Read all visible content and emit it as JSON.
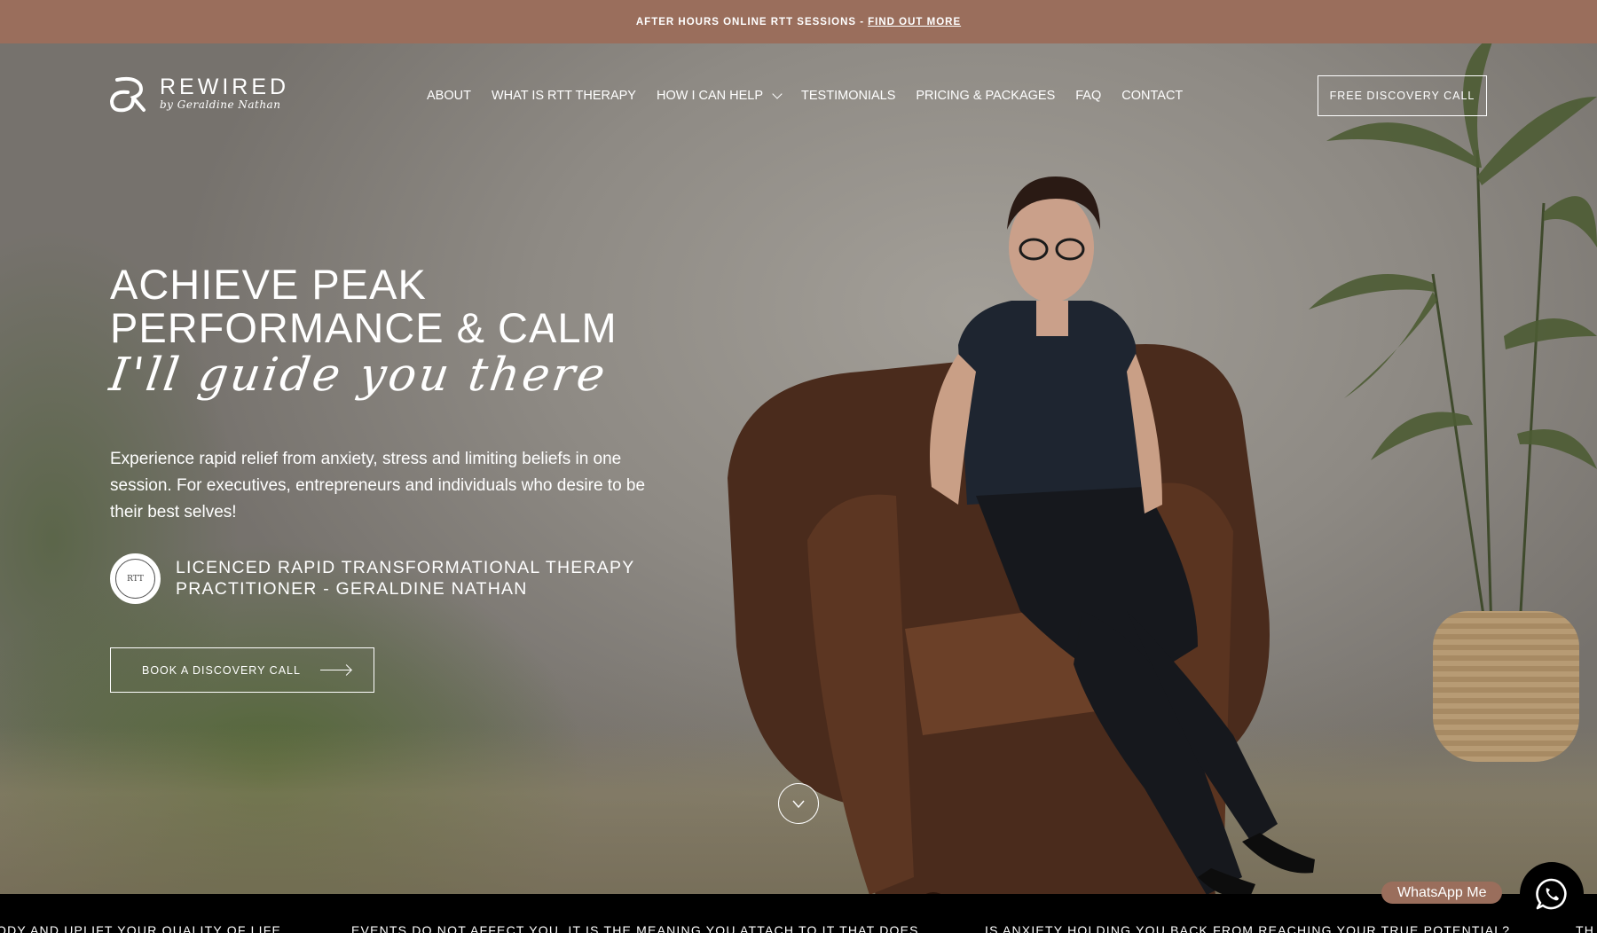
{
  "announcement": {
    "text": "AFTER HOURS ONLINE RTT SESSIONS -",
    "link": "FIND OUT MORE"
  },
  "logo": {
    "brand": "REWIRED",
    "tagline": "by Geraldine Nathan"
  },
  "nav": {
    "items": [
      {
        "label": "ABOUT"
      },
      {
        "label": "WHAT IS RTT THERAPY"
      },
      {
        "label": "HOW I CAN HELP",
        "dropdown": true
      },
      {
        "label": "TESTIMONIALS"
      },
      {
        "label": "PRICING & PACKAGES"
      },
      {
        "label": "FAQ"
      },
      {
        "label": "CONTACT"
      }
    ],
    "cta": "FREE DISCOVERY CALL"
  },
  "hero": {
    "heading_line1": "ACHIEVE PEAK",
    "heading_line2": "PERFORMANCE & CALM",
    "script": "I'll guide you there",
    "description": "Experience rapid relief from anxiety, stress and limiting beliefs in one session. For executives, entrepreneurs and individuals who desire to be their best selves!",
    "badge_mark": "RTT",
    "badge_line1": "LICENCED RAPID TRANSFORMATIONAL THERAPY",
    "badge_line2": "PRACTITIONER - GERALDINE NATHAN",
    "cta": "BOOK A DISCOVERY CALL"
  },
  "marquee": {
    "items": [
      "ODY AND UPLIFT YOUR QUALITY OF LIFE",
      "EVENTS DO NOT AFFECT YOU, IT IS THE MEANING YOU ATTACH TO IT THAT DOES",
      "IS ANXIETY HOLDING YOU BACK FROM REACHING YOUR TRUE POTENTIAL?",
      "TH"
    ]
  },
  "whatsapp": {
    "label": "WhatsApp Me"
  },
  "colors": {
    "accent": "#9a6e5c",
    "marquee_bg": "#000000"
  }
}
